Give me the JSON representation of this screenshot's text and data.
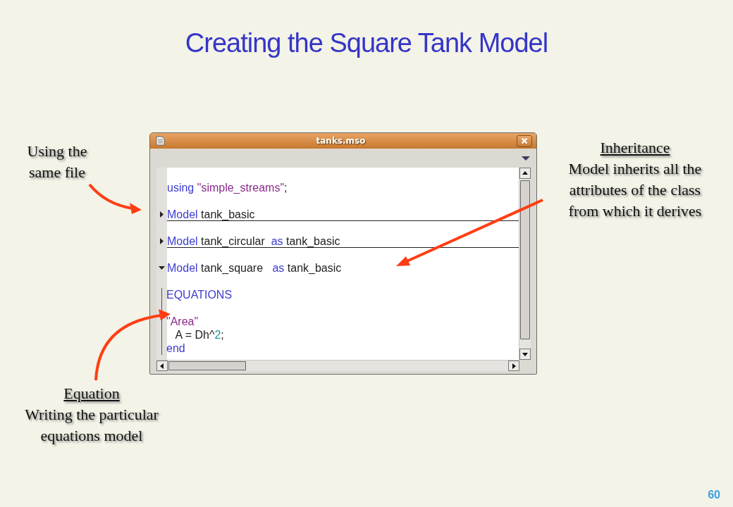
{
  "slide": {
    "title": "Creating the Square Tank Model",
    "page_number": "60"
  },
  "window": {
    "title": "tanks.mso"
  },
  "editor": {
    "lines": [
      {
        "spaced": true,
        "tokens": [
          {
            "kind": "keyword",
            "text": "using "
          },
          {
            "kind": "string",
            "text": "\"simple_streams\""
          },
          {
            "kind": "plain",
            "text": ";"
          }
        ]
      },
      {
        "expanded": false,
        "spaced": true,
        "tokens": [
          {
            "kind": "keyword",
            "text": "Model "
          },
          {
            "kind": "plain",
            "text": "tank_basic"
          }
        ]
      },
      {
        "expanded": false,
        "spaced": true,
        "tokens": [
          {
            "kind": "keyword",
            "text": "Model "
          },
          {
            "kind": "plain",
            "text": "tank_circular  "
          },
          {
            "kind": "keyword",
            "text": "as "
          },
          {
            "kind": "plain",
            "text": "tank_basic"
          }
        ]
      },
      {
        "expanded": true,
        "spaced": true,
        "tokens": [
          {
            "kind": "keyword",
            "text": "Model "
          },
          {
            "kind": "plain",
            "text": "tank_square   "
          },
          {
            "kind": "keyword",
            "text": "as "
          },
          {
            "kind": "plain",
            "text": "tank_basic"
          }
        ],
        "children": [
          {
            "spaced": true,
            "tokens": [
              {
                "kind": "keyword",
                "text": "EQUATIONS"
              }
            ]
          },
          {
            "spaced": true,
            "tokens": [
              {
                "kind": "string",
                "text": "\"Area\""
              }
            ]
          },
          {
            "spaced": false,
            "tokens": [
              {
                "kind": "plain",
                "text": "   A = Dh^"
              },
              {
                "kind": "number",
                "text": "2"
              },
              {
                "kind": "plain",
                "text": ";"
              }
            ]
          },
          {
            "spaced": false,
            "tokens": [
              {
                "kind": "keyword",
                "text": "end"
              }
            ]
          }
        ]
      }
    ]
  },
  "left_note": {
    "body": [
      "Using the",
      "same file"
    ]
  },
  "right_note": {
    "heading": "Inheritance",
    "body": [
      "Model inherits all the",
      "attributes of the class",
      "from which it derives"
    ]
  },
  "bottom_note": {
    "heading": "Equation",
    "body": [
      "Writing the particular",
      "equations model"
    ]
  }
}
